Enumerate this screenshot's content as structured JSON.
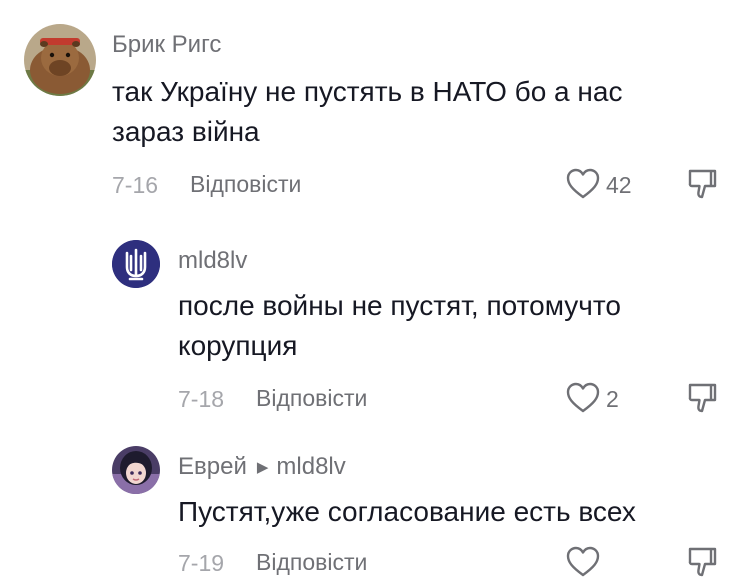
{
  "comments": [
    {
      "username": "Брик Ригс",
      "text_line1": "так Україну не пустять в НАТО бо а нас",
      "text_line2": "зараз війна",
      "date": "7-16",
      "reply_label": "Відповісти",
      "likes": "42"
    },
    {
      "username": "mld8lv",
      "text_line1": "после войны не пустят, потомучто",
      "text_line2": "корупция",
      "date": "7-18",
      "reply_label": "Відповісти",
      "likes": "2"
    },
    {
      "username": "Еврей",
      "reply_to": "mld8lv",
      "text_line1": "Пустят,уже согласование есть всех",
      "date": "7-19",
      "reply_label": "Відповісти",
      "likes": ""
    }
  ],
  "icons": {
    "like": "heart-outline-icon",
    "dislike": "thumbs-down-outline-icon",
    "reply_arrow": "triangle-right-icon"
  },
  "colors": {
    "text": "#161823",
    "secondary": "#6f7075",
    "muted": "#a5a6ab",
    "avatar2_bg": "#2e2f7e"
  }
}
